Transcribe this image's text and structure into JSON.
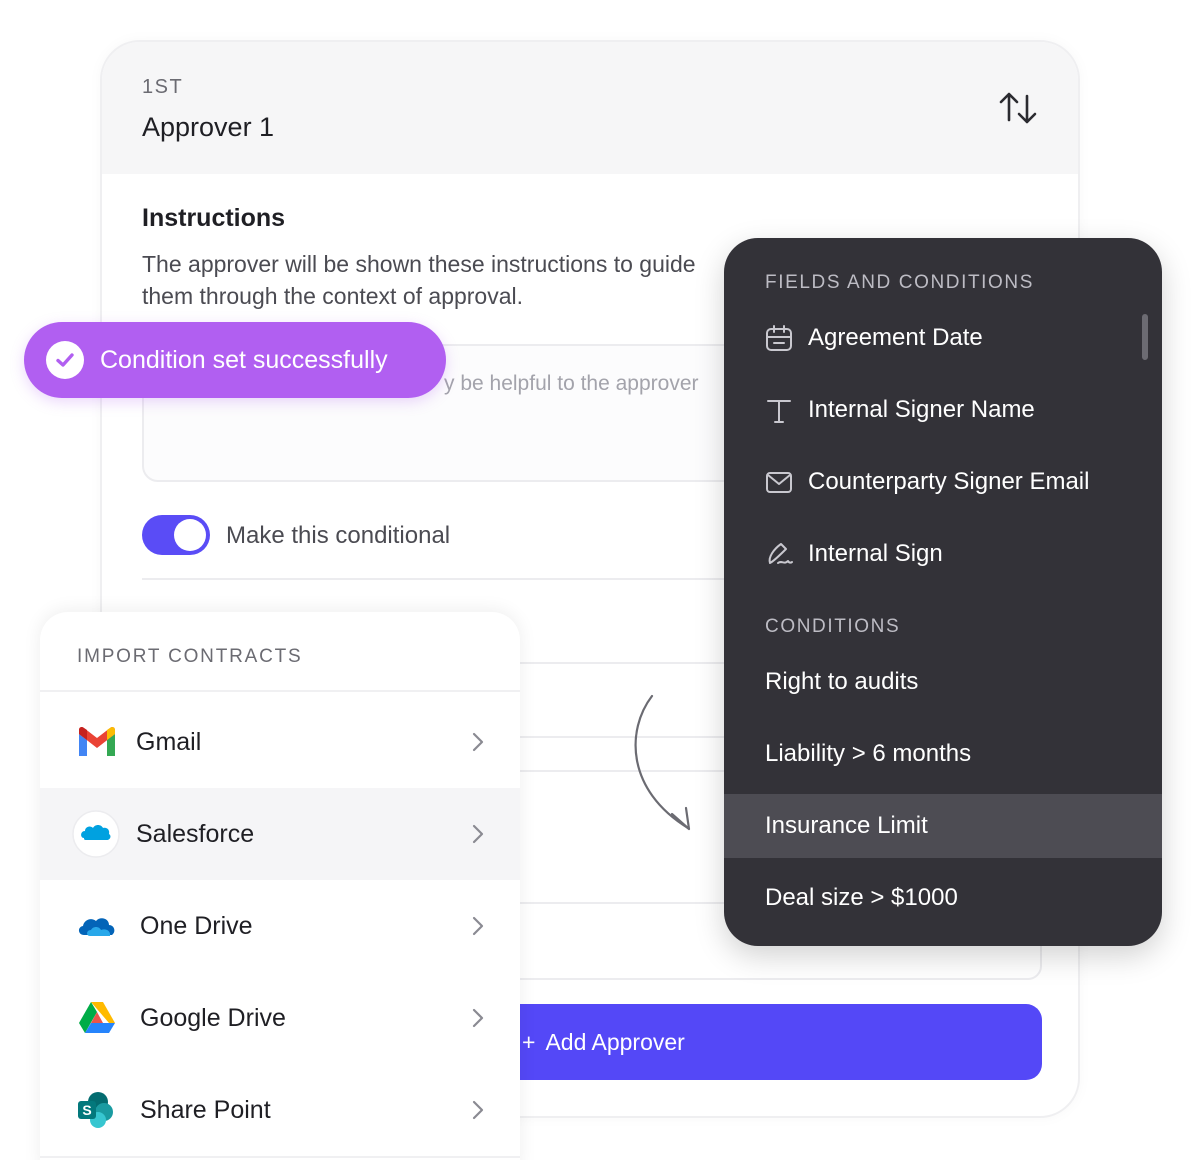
{
  "approver": {
    "step": "1ST",
    "title": "Approver 1",
    "instructions_heading": "Instructions",
    "instructions_desc": "The approver will be shown these instructions to guide them through the context of approval.",
    "instructions_placeholder": "y be helpful to the approver",
    "conditional_label": "Make this conditional",
    "conditional_on": true,
    "add_button": "Add Approver",
    "add_button_icon": "plus-icon"
  },
  "toast": {
    "message": "Condition set successfully",
    "icon": "check-circle-icon",
    "color": "#b15ff1"
  },
  "fields_panel": {
    "fields_heading": "FIELDS AND CONDITIONS",
    "fields": [
      {
        "label": "Agreement Date",
        "icon": "calendar-icon"
      },
      {
        "label": "Internal Signer Name",
        "icon": "text-icon"
      },
      {
        "label": "Counterparty Signer Email",
        "icon": "mail-icon"
      },
      {
        "label": "Internal Sign",
        "icon": "signature-icon"
      }
    ],
    "conditions_heading": "CONDITIONS",
    "conditions": [
      {
        "label": "Right to audits"
      },
      {
        "label": "Liability > 6 months"
      },
      {
        "label": "Insurance Limit",
        "active": true
      },
      {
        "label": "Deal size > $1000"
      }
    ]
  },
  "import_panel": {
    "title": "IMPORT CONTRACTS",
    "sources": [
      {
        "name": "Gmail",
        "icon": "gmail-icon"
      },
      {
        "name": "Salesforce",
        "icon": "salesforce-icon",
        "highlighted": true
      },
      {
        "name": "One Drive",
        "icon": "onedrive-icon"
      },
      {
        "name": "Google Drive",
        "icon": "google-drive-icon"
      },
      {
        "name": "Share Point",
        "icon": "sharepoint-icon"
      }
    ]
  },
  "colors": {
    "accent": "#5448f7",
    "toast": "#b15ff1",
    "dark_panel": "#333238"
  }
}
